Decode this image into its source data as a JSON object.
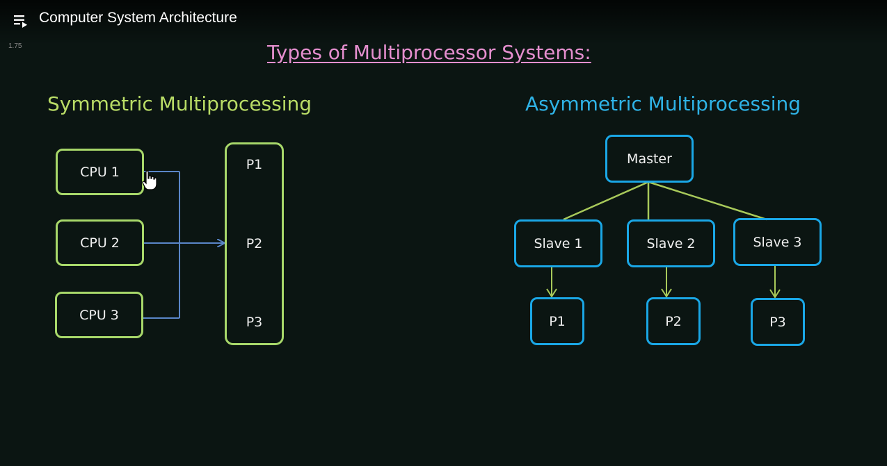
{
  "player": {
    "title": "Computer System Architecture",
    "speed": "1.75"
  },
  "slide": {
    "title": "Types of Multiprocessor Systems:",
    "symmetric": {
      "heading": "Symmetric Multiprocessing",
      "cpus": [
        "CPU 1",
        "CPU 2",
        "CPU 3"
      ],
      "processes": [
        "P1",
        "P2",
        "P3"
      ]
    },
    "asymmetric": {
      "heading": "Asymmetric Multiprocessing",
      "master": "Master",
      "slaves": [
        "Slave 1",
        "Slave 2",
        "Slave 3"
      ],
      "processes": [
        "P1",
        "P2",
        "P3"
      ]
    }
  },
  "colors": {
    "title_pink": "#e58fcf",
    "symmetric_green": "#b9dc66",
    "asymmetric_blue": "#2fb3e6",
    "connector_blue": "#5a86c8",
    "connector_green": "#a8c95a"
  }
}
